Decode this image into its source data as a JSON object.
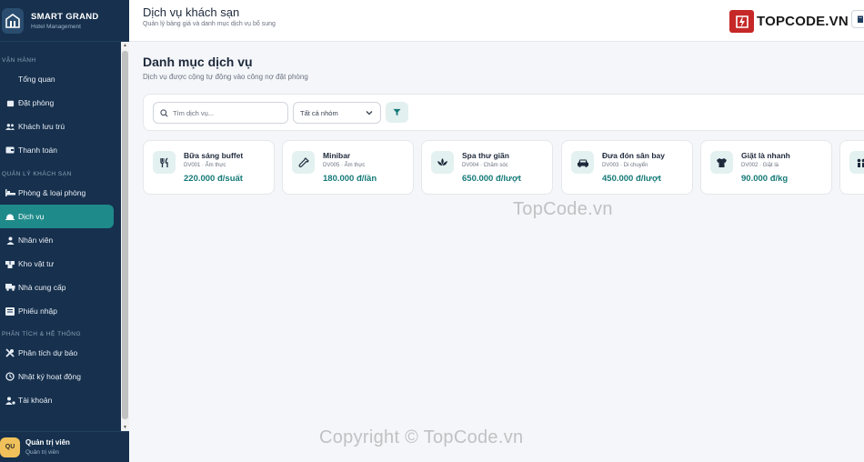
{
  "brand": {
    "name": "SMART GRAND",
    "subtitle": "Hotel Management"
  },
  "sidebar": {
    "sections": [
      {
        "title": "VẬN HÀNH",
        "items": [
          {
            "label": "Tổng quan",
            "icon": "grid-icon"
          },
          {
            "label": "Đặt phòng",
            "icon": "calendar-icon"
          },
          {
            "label": "Khách lưu trú",
            "icon": "users-icon"
          },
          {
            "label": "Thanh toán",
            "icon": "wallet-icon"
          }
        ]
      },
      {
        "title": "QUẢN LÝ KHÁCH SẠN",
        "items": [
          {
            "label": "Phòng & loại phòng",
            "icon": "bed-icon"
          },
          {
            "label": "Dịch vụ",
            "icon": "bell-icon",
            "active": true
          },
          {
            "label": "Nhân viên",
            "icon": "user-icon"
          },
          {
            "label": "Kho vật tư",
            "icon": "box-icon"
          },
          {
            "label": "Nhà cung cấp",
            "icon": "truck-icon"
          },
          {
            "label": "Phiếu nhập",
            "icon": "receipt-icon"
          }
        ]
      },
      {
        "title": "PHÂN TÍCH & HỆ THỐNG",
        "items": [
          {
            "label": "Phân tích dự báo",
            "icon": "tools-icon"
          },
          {
            "label": "Nhật ký hoạt động",
            "icon": "history-icon"
          },
          {
            "label": "Tài khoản",
            "icon": "user-gear-icon"
          }
        ]
      }
    ]
  },
  "user": {
    "initials": "QU",
    "name": "Quản trị viên",
    "role": "Quản trị viên"
  },
  "header": {
    "title": "Dịch vụ khách sạn",
    "subtitle": "Quản lý bảng giá và danh mục dịch vụ bổ sung",
    "logo_text": "TOPCODE.VN"
  },
  "main": {
    "title": "Danh mục dịch vụ",
    "subtitle": "Dịch vụ được cộng tự động vào công nợ đặt phòng",
    "search_placeholder": "Tìm dịch vụ...",
    "group_select": "Tất cả nhóm"
  },
  "services": [
    {
      "name": "Bữa sáng buffet",
      "meta": "DV001 · Ẩm thực",
      "price": "220.000 đ/suất",
      "icon": "utensils-icon"
    },
    {
      "name": "Minibar",
      "meta": "DV005 · Ẩm thực",
      "price": "180.000 đ/lần",
      "icon": "bottle-icon"
    },
    {
      "name": "Spa thư giãn",
      "meta": "DV004 · Chăm sóc",
      "price": "650.000 đ/lượt",
      "icon": "spa-icon"
    },
    {
      "name": "Đưa đón sân bay",
      "meta": "DV003 · Di chuyển",
      "price": "450.000 đ/lượt",
      "icon": "car-icon"
    },
    {
      "name": "Giặt là nhanh",
      "meta": "DV002 · Giặt là",
      "price": "90.000 đ/kg",
      "icon": "shirt-icon"
    }
  ],
  "watermarks": {
    "center": "TopCode.vn",
    "bottom": "Copyright © TopCode.vn"
  },
  "colors": {
    "sidebar": "#16304d",
    "accent": "#1f8a8a",
    "price": "#157a78",
    "logo_red": "#c62828"
  }
}
